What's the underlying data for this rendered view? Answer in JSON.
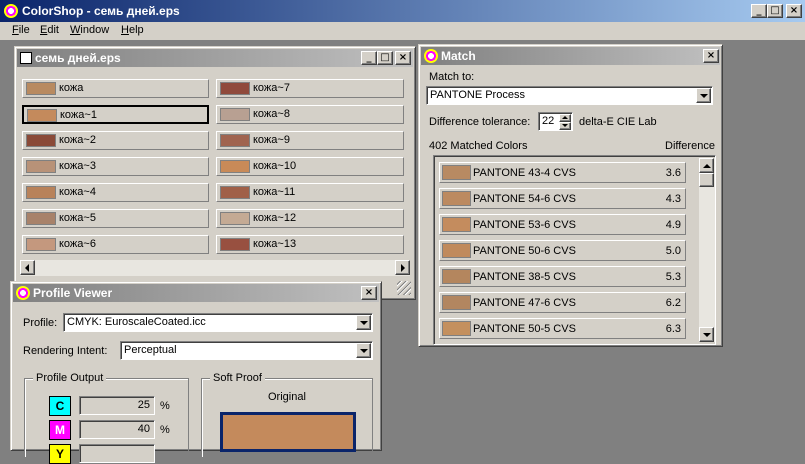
{
  "app": {
    "title": "ColorShop - семь дней.eps",
    "menu": [
      "File",
      "Edit",
      "Window",
      "Help"
    ],
    "menu_underline": [
      "F",
      "E",
      "W",
      "H"
    ]
  },
  "doc_window": {
    "title": "семь дней.eps",
    "swatches_left": [
      {
        "label": "кожа",
        "color": "#b88a60"
      },
      {
        "label": "кожа~1",
        "color": "#c48a5c",
        "selected": true
      },
      {
        "label": "кожа~2",
        "color": "#8a4a38"
      },
      {
        "label": "кожа~3",
        "color": "#b89278"
      },
      {
        "label": "кожа~4",
        "color": "#b8825a"
      },
      {
        "label": "кожа~5",
        "color": "#a8826a"
      },
      {
        "label": "кожа~6",
        "color": "#c4987e"
      }
    ],
    "swatches_right": [
      {
        "label": "кожа~7",
        "color": "#904a3c"
      },
      {
        "label": "кожа~8",
        "color": "#b8a092"
      },
      {
        "label": "кожа~9",
        "color": "#a06450"
      },
      {
        "label": "кожа~10",
        "color": "#c88a58"
      },
      {
        "label": "кожа~11",
        "color": "#a06048"
      },
      {
        "label": "кожа~12",
        "color": "#c4aa94"
      },
      {
        "label": "кожа~13",
        "color": "#985040"
      }
    ]
  },
  "match_window": {
    "title": "Match",
    "match_to_label": "Match to:",
    "match_to_value": "PANTONE Process",
    "tolerance_label": "Difference tolerance:",
    "tolerance_value": "22",
    "tolerance_unit": "delta-E CIE Lab",
    "matched_count": "402 Matched Colors",
    "difference_header": "Difference",
    "rows": [
      {
        "name": "PANTONE 43-4 CVS",
        "diff": "3.6",
        "color": "#b88a62"
      },
      {
        "name": "PANTONE 54-6 CVS",
        "diff": "4.3",
        "color": "#bc8a60"
      },
      {
        "name": "PANTONE 53-6 CVS",
        "diff": "4.9",
        "color": "#c48c5e"
      },
      {
        "name": "PANTONE 50-6 CVS",
        "diff": "5.0",
        "color": "#c08a5c"
      },
      {
        "name": "PANTONE 38-5 CVS",
        "diff": "5.3",
        "color": "#b4865e"
      },
      {
        "name": "PANTONE 47-6 CVS",
        "diff": "6.2",
        "color": "#b28660"
      },
      {
        "name": "PANTONE 50-5 CVS",
        "diff": "6.3",
        "color": "#c4905e"
      }
    ]
  },
  "profile_window": {
    "title": "Profile Viewer",
    "profile_label": "Profile:",
    "profile_value": "CMYK: EuroscaleCoated.icc",
    "intent_label": "Rendering Intent:",
    "intent_value": "Perceptual",
    "output_group": "Profile Output",
    "softproof_group": "Soft Proof",
    "original_label": "Original",
    "original_color": "#c48a5c",
    "channels": [
      {
        "letter": "C",
        "value": "25",
        "unit": "%",
        "color": "#00ffff"
      },
      {
        "letter": "M",
        "value": "40",
        "unit": "%",
        "color": "#ff00ff"
      },
      {
        "letter": "Y",
        "value": "",
        "unit": "",
        "color": "#ffff00"
      }
    ]
  }
}
